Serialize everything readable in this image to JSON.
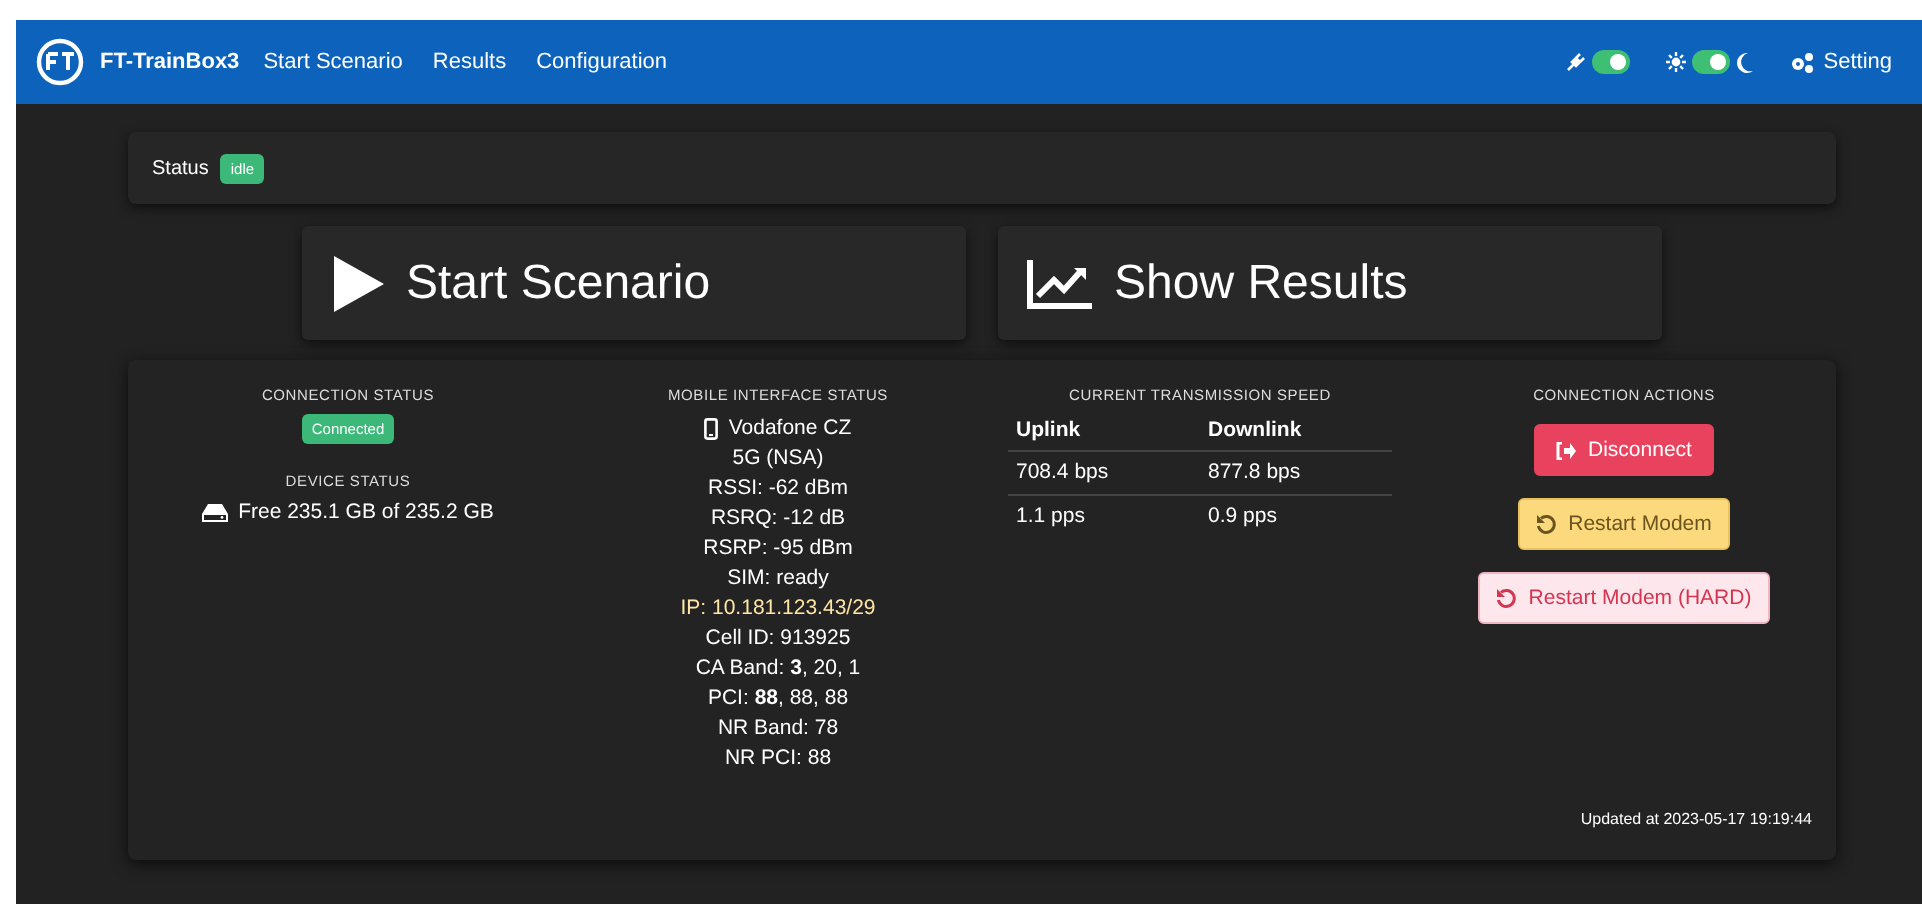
{
  "navbar": {
    "brand": "FT-TrainBox3",
    "links": [
      "Start Scenario",
      "Results",
      "Configuration"
    ],
    "toggles": [
      {
        "kind": "plug",
        "on": true
      },
      {
        "kind": "theme",
        "on": true
      }
    ],
    "settings": "Setting"
  },
  "status": {
    "label": "Status",
    "badge": "idle"
  },
  "actions": [
    {
      "kind": "play",
      "label": "Start Scenario"
    },
    {
      "kind": "chart",
      "label": "Show Results"
    }
  ],
  "panel": {
    "connection": {
      "title": "CONNECTION STATUS",
      "badge": "Connected"
    },
    "device": {
      "title": "DEVICE STATUS",
      "text": "Free 235.1 GB of 235.2 GB"
    },
    "mobile": {
      "title": "MOBILE INTERFACE STATUS",
      "operator": "Vodafone CZ",
      "lines": [
        {
          "text": "5G (NSA)",
          "highlighted": false
        },
        {
          "text": "RSSI: -62 dBm",
          "highlighted": false
        },
        {
          "text": "RSRQ: -12 dB",
          "highlighted": false
        },
        {
          "text": "RSRP: -95 dBm",
          "highlighted": false
        },
        {
          "text": "SIM: ready",
          "highlighted": false
        },
        {
          "text": "IP: 10.181.123.43/29",
          "highlighted": true
        },
        {
          "text": "Cell ID: 913925",
          "highlighted": false
        },
        {
          "text": "CA Band: **3**, 20, 1",
          "highlighted": false
        },
        {
          "text": "PCI: **88**, 88, 88",
          "highlighted": false
        },
        {
          "text": "NR Band: 78",
          "highlighted": false
        },
        {
          "text": "NR PCI: 88",
          "highlighted": false
        }
      ]
    },
    "speed": {
      "title": "CURRENT TRANSMISSION SPEED",
      "columns": [
        "Uplink",
        "Downlink"
      ],
      "rows": [
        [
          "708.4 bps",
          "877.8 bps"
        ],
        [
          "1.1 pps",
          "0.9 pps"
        ]
      ]
    },
    "connection_actions": {
      "title": "CONNECTION ACTIONS",
      "buttons": [
        {
          "kind": "danger",
          "label": "Disconnect"
        },
        {
          "kind": "warning",
          "label": "Restart Modem"
        },
        {
          "kind": "danger-light",
          "label": "Restart Modem (HARD)"
        }
      ]
    },
    "updated": "Updated at 2023-05-17 19:19:44"
  }
}
